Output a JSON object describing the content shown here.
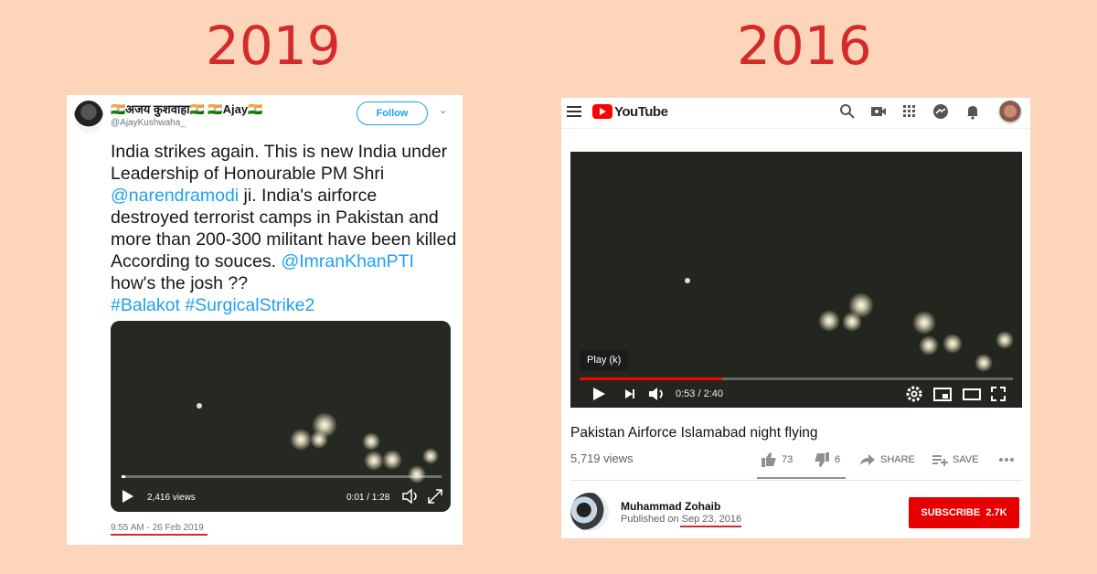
{
  "labels": {
    "left_year": "2019",
    "right_year": "2016"
  },
  "tweet": {
    "display_name": "🇮🇳अजय कुशवाहा🇮🇳 🇮🇳Ajay🇮🇳",
    "handle": "@AjayKushwaha_",
    "follow_label": "Follow",
    "text_parts": {
      "p1": "India strikes again. This is new India under Leadership of Honourable PM Shri ",
      "mention1": "@narendramodi",
      "p2": " ji. India's airforce destroyed terrorist camps in Pakistan and more than 200-300 militant have been killed According to souces. ",
      "mention2": "@ImranKhanPTI",
      "p3": " how's the josh ??",
      "hashtag1": "#Balakot",
      "hashtag2": "#SurgicalStrike2"
    },
    "video": {
      "views": "2,416 views",
      "duration": "0:01 / 1:28",
      "progress": 0.01
    },
    "timestamp": "9:55 AM - 26 Feb 2019"
  },
  "youtube": {
    "logo_text": "YouTube",
    "video": {
      "tooltip": "Play (k)",
      "time": "0:53 / 2:40",
      "progress": 0.33
    },
    "title": "Pakistan Airforce Islamabad night flying",
    "views": "5,719 views",
    "likes": "73",
    "dislikes": "6",
    "share_label": "SHARE",
    "save_label": "SAVE",
    "channel": "Muhammad Zohaib",
    "published_prefix": "Published on ",
    "published_date": "Sep 23, 2016",
    "subscribe_label": "SUBSCRIBE",
    "subscriber_count": "2.7K"
  },
  "colors": {
    "accent_red": "#d42a2a",
    "twitter_blue": "#1da1f2",
    "youtube_red": "#e60000",
    "background": "#fdd5bb"
  }
}
